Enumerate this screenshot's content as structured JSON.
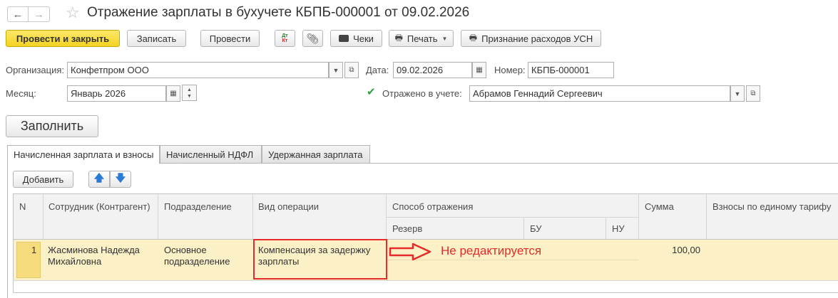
{
  "title": "Отражение зарплаты в бухучете КБПБ-000001 от 09.02.2026",
  "toolbar": {
    "post_close": "Провести и закрыть",
    "save": "Записать",
    "post": "Провести",
    "dt_kt": "ДтКт",
    "cheki": "Чеки",
    "print": "Печать",
    "usn": "Признание расходов УСН"
  },
  "form": {
    "org_label": "Организация:",
    "org_value": "Конфетпром ООО",
    "date_label": "Дата:",
    "date_value": "09.02.2026",
    "number_label": "Номер:",
    "number_value": "КБПБ-000001",
    "month_label": "Месяц:",
    "month_value": "Январь 2026",
    "reflected_label": "Отражено в учете:",
    "reflected_checked": true,
    "responsible_value": "Абрамов Геннадий Сергеевич"
  },
  "fill_button": "Заполнить",
  "tabs": [
    {
      "label": "Начисленная зарплата и взносы",
      "active": true
    },
    {
      "label": "Начисленный НДФЛ",
      "active": false
    },
    {
      "label": "Удержанная зарплата",
      "active": false
    }
  ],
  "table_toolbar": {
    "add": "Добавить"
  },
  "table": {
    "headers": {
      "n": "N",
      "employee": "Сотрудник (Контрагент)",
      "department": "Подразделение",
      "operation": "Вид операции",
      "method": "Способ отражения",
      "reserve": "Резерв",
      "bu": "БУ",
      "nu": "НУ",
      "sum": "Сумма",
      "contributions": "Взносы по единому тарифу"
    },
    "rows": [
      {
        "n": "1",
        "employee": "Жасминова Надежда Михайловна",
        "department": "Основное подразделение",
        "operation": "Компенсация за задержку зарплаты",
        "sum": "100,00"
      }
    ]
  },
  "annotation": "Не редактируется",
  "colors": {
    "primary_button": "#f3d321",
    "selected_row": "#fbf0c6",
    "annotation_red": "#e52b2b",
    "checkbox_green": "#2f9e44"
  }
}
